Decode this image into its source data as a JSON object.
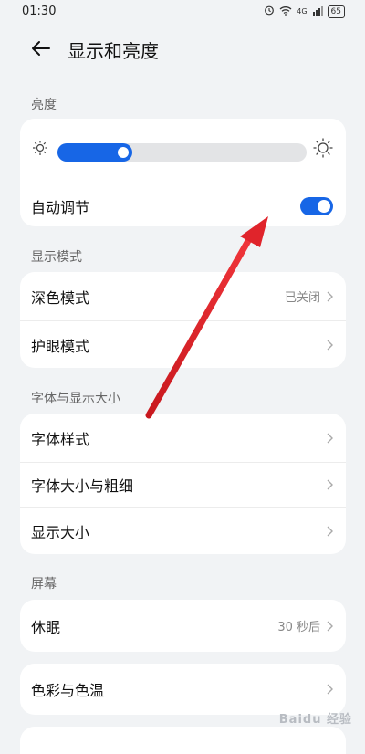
{
  "status_bar": {
    "time": "01:30",
    "signal_text": "4G",
    "battery": "65"
  },
  "header": {
    "title": "显示和亮度"
  },
  "brightness": {
    "section_label": "亮度",
    "level": 0.3,
    "auto_label": "自动调节",
    "auto_on": true
  },
  "display_mode": {
    "section_label": "显示模式",
    "items": [
      {
        "label": "深色模式",
        "value": "已关闭"
      },
      {
        "label": "护眼模式",
        "value": ""
      }
    ]
  },
  "font_size": {
    "section_label": "字体与显示大小",
    "items": [
      {
        "label": "字体样式"
      },
      {
        "label": "字体大小与粗细"
      },
      {
        "label": "显示大小"
      }
    ]
  },
  "screen": {
    "section_label": "屏幕",
    "sleep_label": "休眠",
    "sleep_value": "30 秒后",
    "color_label": "色彩与色温"
  },
  "colors": {
    "accent": "#1766e6",
    "annotation_arrow": "#e0242b"
  },
  "watermark": "Baidu 经验"
}
